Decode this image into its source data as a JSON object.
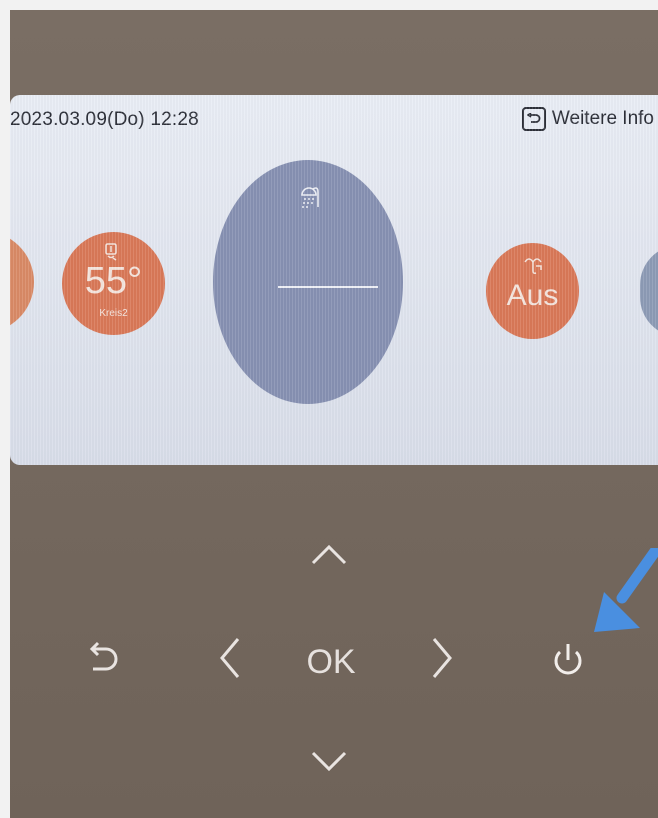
{
  "status_bar": {
    "datetime": "2023.03.09(Do)  12:28",
    "info_label": "Weitere Info"
  },
  "tiles": {
    "heating": {
      "value": "55°",
      "label": "Kreis2",
      "icon": "radiator-thermometer-icon"
    },
    "hot_water": {
      "icon": "shower-icon",
      "value_placeholder": "——"
    },
    "mode": {
      "value": "Aus",
      "icon": "fan-mode-icon"
    }
  },
  "keypad": {
    "ok_label": "OK",
    "icons": [
      "back-icon",
      "chevron-up-icon",
      "chevron-down-icon",
      "chevron-left-icon",
      "chevron-right-icon",
      "power-icon"
    ]
  },
  "colors": {
    "tile_orange": "#d97858",
    "tile_blue": "#8791b2",
    "annotation_arrow": "#4a8fe0"
  }
}
